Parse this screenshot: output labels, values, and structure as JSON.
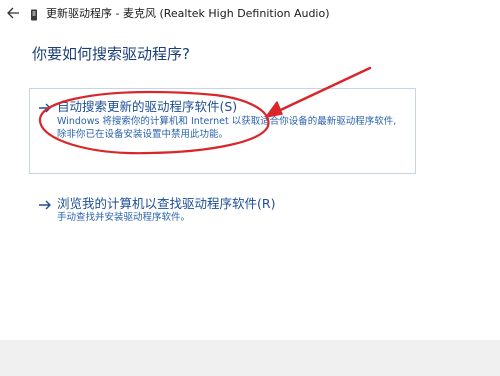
{
  "window": {
    "title": "更新驱动程序 - 麦克风 (Realtek High Definition Audio)"
  },
  "main": {
    "heading": "你要如何搜索驱动程序?",
    "options": [
      {
        "title": "自动搜索更新的驱动程序软件(S)",
        "description_line1": "Windows 将搜索你的计算机和 Internet 以获取适合你设备的最新驱动程序软件,",
        "description_line2": "除非你已在设备安装设置中禁用此功能。"
      },
      {
        "title": "浏览我的计算机以查找驱动程序软件(R)",
        "description_line1": "手动查找并安装驱动程序软件。"
      }
    ]
  },
  "colors": {
    "link": "#1c4e96",
    "heading": "#1c3f7a",
    "annotation": "#d9262b",
    "footer": "#f0f0f0"
  },
  "icons": {
    "back": "back-arrow-icon",
    "device": "device-icon",
    "option_arrow": "right-arrow-icon"
  }
}
